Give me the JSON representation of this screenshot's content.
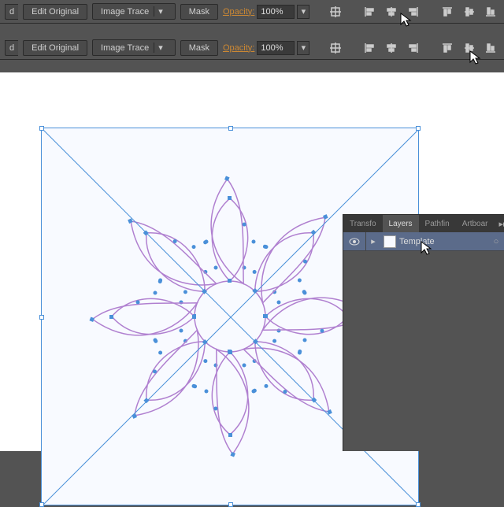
{
  "toolbar": {
    "truncated_btn": "d",
    "edit_original": "Edit Original",
    "image_trace": "Image Trace",
    "mask": "Mask",
    "opacity_label": "Opacity:",
    "opacity_value": "100%"
  },
  "panel": {
    "tabs": {
      "transform": "Transfo",
      "layers": "Layers",
      "pathfinder": "Pathfin",
      "artboards": "Artboar"
    },
    "layer": {
      "name": "Template"
    }
  }
}
